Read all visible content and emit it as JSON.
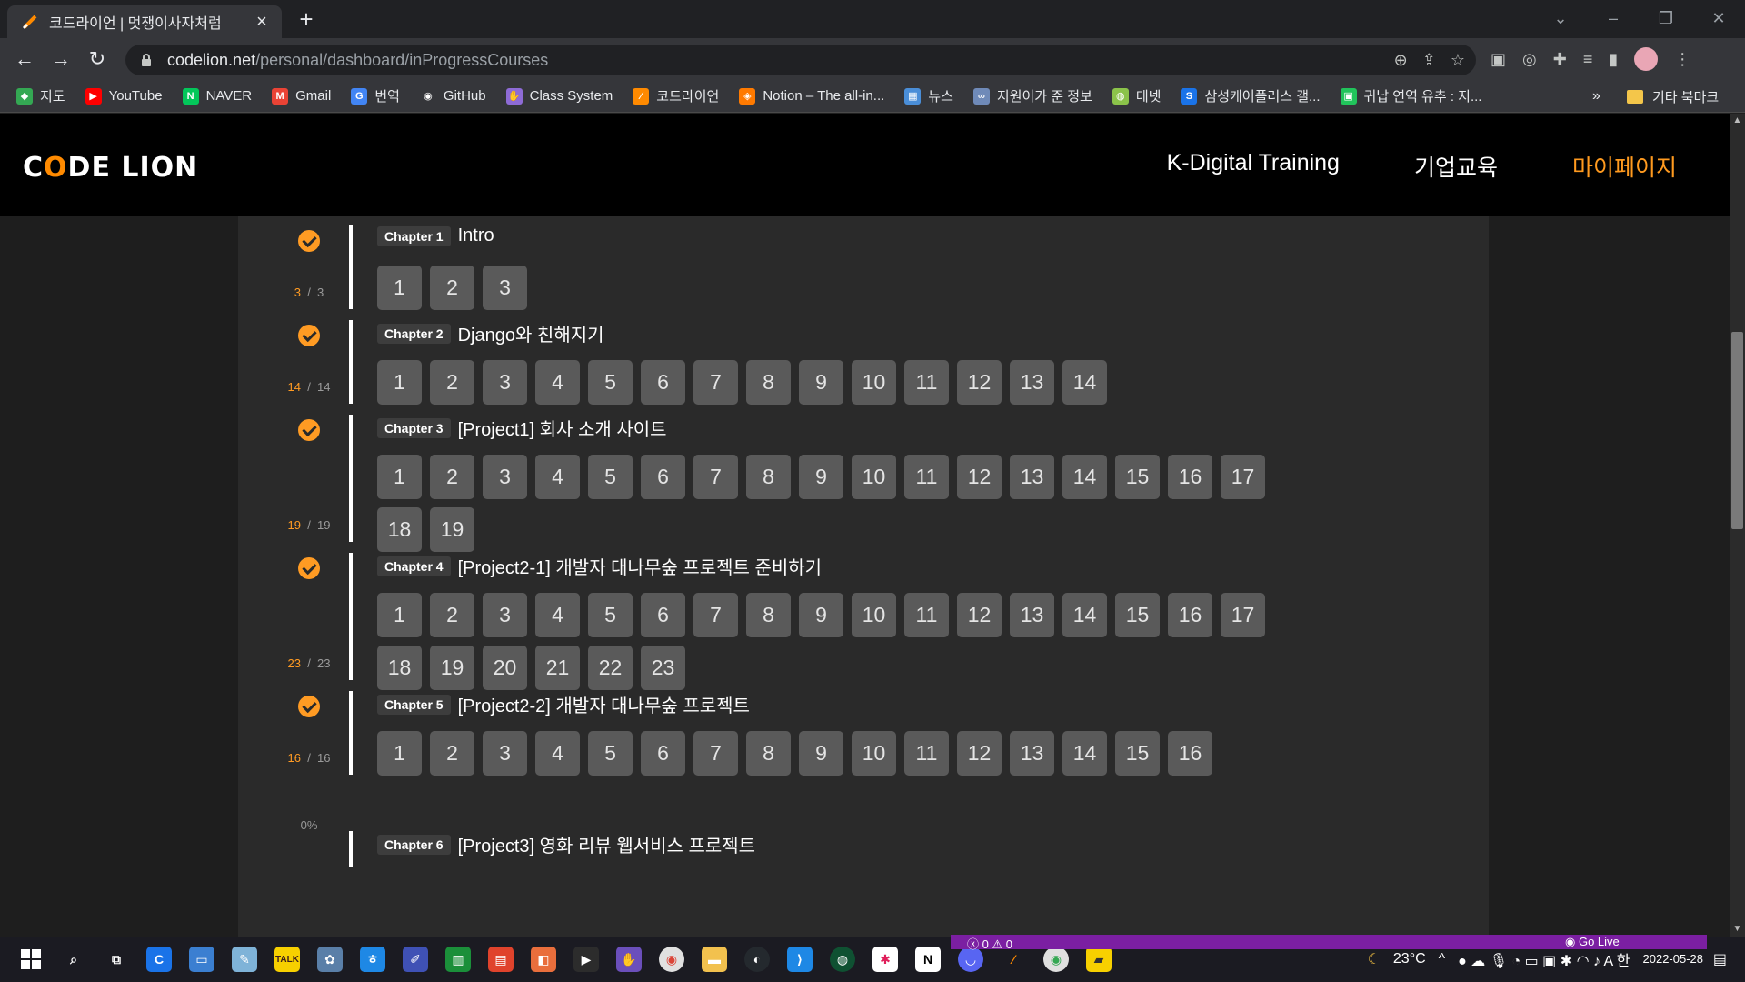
{
  "browser": {
    "tab_title": "코드라이언 | 멋쟁이사자처럼",
    "url_host": "codelion.net",
    "url_path": "/personal/dashboard/inProgressCourses",
    "bookmarks": [
      {
        "label": "지도",
        "color": "#34a853"
      },
      {
        "label": "YouTube",
        "color": "#ff0000"
      },
      {
        "label": "NAVER",
        "color": "#03c75a"
      },
      {
        "label": "Gmail",
        "color": "#ea4335"
      },
      {
        "label": "번역",
        "color": "#4285f4"
      },
      {
        "label": "GitHub",
        "color": "#ffffff"
      },
      {
        "label": "Class System",
        "color": "#8e6bd6"
      },
      {
        "label": "코드라이언",
        "color": "#ff8a00"
      },
      {
        "label": "Notion – The all-in...",
        "color": "#ff7a00"
      },
      {
        "label": "뉴스",
        "color": "#4a8ed8"
      },
      {
        "label": "지원이가 준 정보",
        "color": "#6f8ab8"
      },
      {
        "label": "테넷",
        "color": "#8bc34a"
      },
      {
        "label": "삼성케어플러스 갤...",
        "color": "#1a73e8"
      },
      {
        "label": "귀납 연역 유추 : 지...",
        "color": "#21c45b"
      }
    ],
    "bookmarks_more": "»",
    "bookmarks_other": "기타 북마크"
  },
  "site": {
    "logo_left": "C",
    "logo_slash": "O",
    "logo_right": "DE LION",
    "nav": [
      {
        "label": "K-Digital Training",
        "active": false
      },
      {
        "label": "기업교육",
        "active": false
      },
      {
        "label": "마이페이지",
        "active": true
      }
    ]
  },
  "chapters": [
    {
      "badge": "Chapter 1",
      "title": "Intro",
      "done": "3",
      "total": "3",
      "lessons": 3
    },
    {
      "badge": "Chapter 2",
      "title": "Django와 친해지기",
      "done": "14",
      "total": "14",
      "lessons": 14
    },
    {
      "badge": "Chapter 3",
      "title": "[Project1] 회사 소개 사이트",
      "done": "19",
      "total": "19",
      "lessons": 19
    },
    {
      "badge": "Chapter 4",
      "title": "[Project2-1] 개발자 대나무숲 프로젝트 준비하기",
      "done": "23",
      "total": "23",
      "lessons": 23
    },
    {
      "badge": "Chapter 5",
      "title": "[Project2-2] 개발자 대나무숲 프로젝트",
      "done": "16",
      "total": "16",
      "lessons": 16
    },
    {
      "badge": "Chapter 6",
      "title": "[Project3] 영화 리뷰 웹서비스 프로젝트",
      "done": "0%",
      "total": "",
      "lessons": 0
    }
  ],
  "statusbar": {
    "problems": "ⓧ 0 ⚠ 0",
    "golive": "Go Live"
  },
  "taskbar": {
    "weather": "23°C",
    "date": "2022-05-28"
  }
}
